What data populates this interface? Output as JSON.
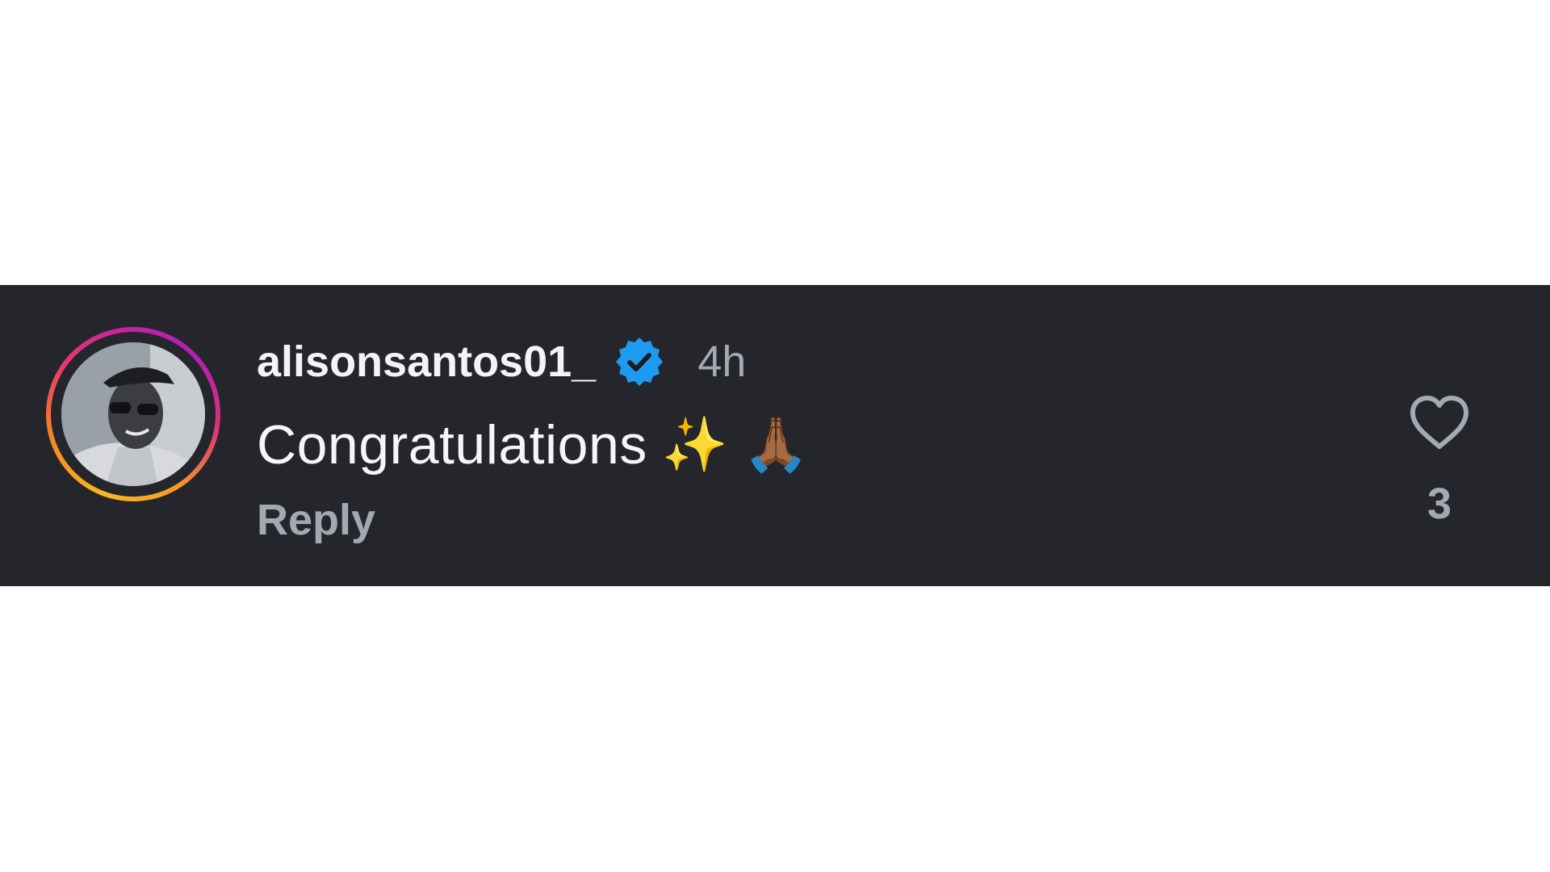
{
  "comment": {
    "username": "alisonsantos01_",
    "verified": true,
    "time": "4h",
    "text": "Congratulations",
    "emojis": [
      "✨",
      "🙏🏾"
    ],
    "reply_label": "Reply",
    "like_count": "3"
  },
  "colors": {
    "background": "#24262c",
    "verified_badge": "#1d9bf0",
    "secondary_text": "#a5a9b0",
    "primary_text": "#f5f6f8"
  },
  "icons": {
    "verified": "verified-badge-icon",
    "like": "heart-outline-icon"
  }
}
